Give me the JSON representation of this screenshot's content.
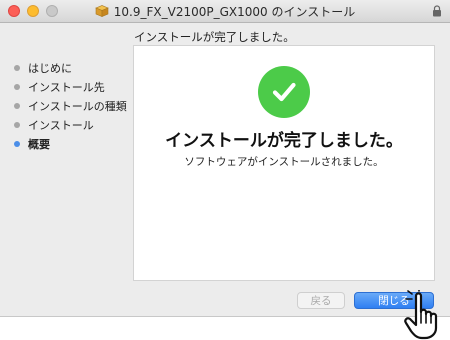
{
  "window": {
    "title": "10.9_FX_V2100P_GX1000 のインストール",
    "header": "インストールが完了しました。"
  },
  "sidebar": {
    "steps": [
      {
        "label": "はじめに",
        "current": false
      },
      {
        "label": "インストール先",
        "current": false
      },
      {
        "label": "インストールの種類",
        "current": false
      },
      {
        "label": "インストール",
        "current": false
      },
      {
        "label": "概要",
        "current": true
      }
    ]
  },
  "content": {
    "headline": "インストールが完了しました。",
    "message": "ソフトウェアがインストールされました。"
  },
  "buttons": {
    "back_label": "戻る",
    "close_label": "閉じる"
  },
  "icons": {
    "title_icon": "package-icon",
    "lock": "lock-icon",
    "success": "checkmark-icon",
    "pointer": "hand-pointer-icon"
  },
  "colors": {
    "accent": "#2f7ff2",
    "success": "#4ccb49",
    "current_step": "#4b8ee8"
  }
}
